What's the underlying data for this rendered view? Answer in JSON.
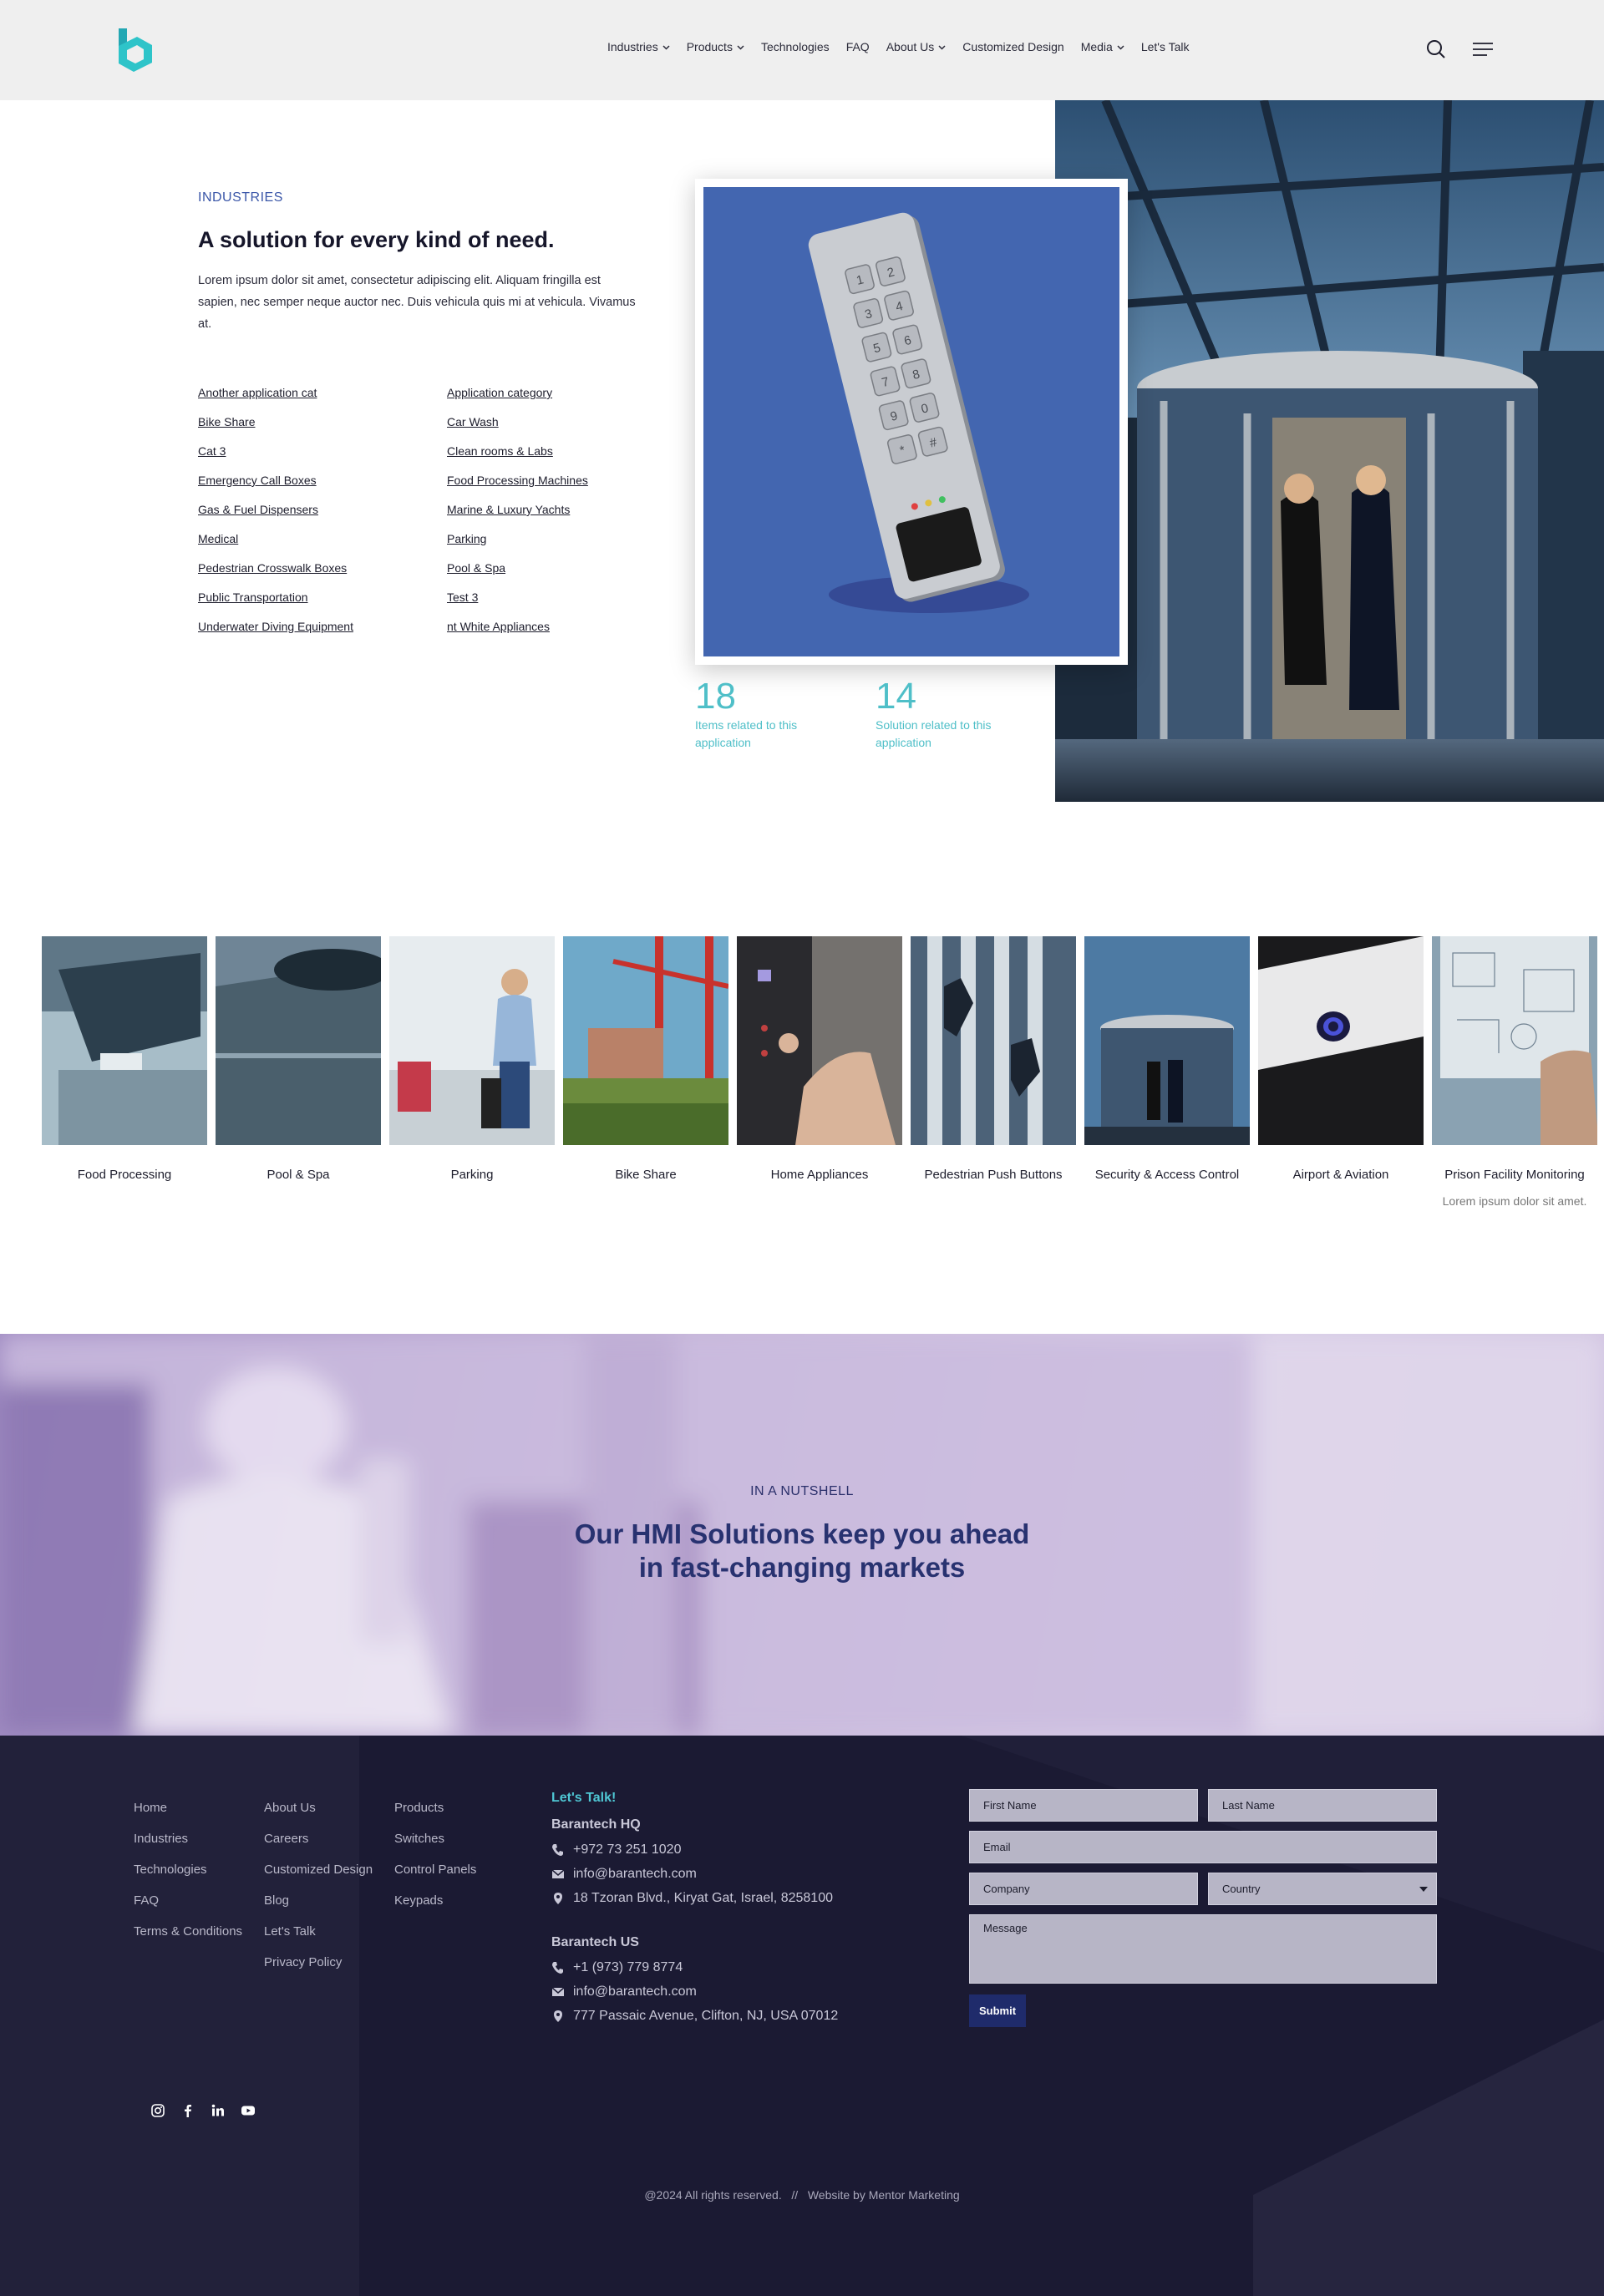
{
  "header": {
    "nav": [
      {
        "label": "Industries",
        "dropdown": true
      },
      {
        "label": "Products",
        "dropdown": true
      },
      {
        "label": "Technologies",
        "dropdown": false
      },
      {
        "label": "FAQ",
        "dropdown": false
      },
      {
        "label": "About Us",
        "dropdown": true
      },
      {
        "label": "Customized Design",
        "dropdown": false
      },
      {
        "label": "Media",
        "dropdown": true
      },
      {
        "label": "Let's Talk",
        "dropdown": false
      }
    ],
    "icons": [
      "search-icon",
      "menu-icon"
    ]
  },
  "hero": {
    "eyebrow": "INDUSTRIES",
    "title": "A solution for every kind of need.",
    "paragraph": "Lorem ipsum dolor sit amet, consectetur adipiscing elit. Aliquam fringilla est sapien, nec semper neque auctor nec. Duis vehicula quis mi at vehicula. Vivamus at.",
    "links": [
      "Another application cat",
      "Application category",
      "Bike Share",
      "Car Wash",
      "Cat 3",
      "Clean rooms & Labs",
      "Emergency Call Boxes",
      "Food Processing Machines",
      "Gas & Fuel Dispensers",
      "Marine & Luxury Yachts",
      "Medical",
      "Parking",
      "Pedestrian Crosswalk Boxes",
      "Pool & Spa",
      "Public Transportation",
      "Test 3",
      "Underwater Diving Equipment",
      "nt White Appliances"
    ],
    "keypad_keys": [
      "1",
      "2",
      "3",
      "4",
      "5",
      "6",
      "7",
      "8",
      "9",
      "0",
      "*",
      "#"
    ],
    "stats": [
      {
        "number": "18",
        "label": "Items related to this application"
      },
      {
        "number": "14",
        "label": "Solution related to this application"
      }
    ]
  },
  "categories": [
    {
      "label": "Food Processing",
      "desc": ""
    },
    {
      "label": "Pool & Spa",
      "desc": ""
    },
    {
      "label": "Parking",
      "desc": ""
    },
    {
      "label": "Bike Share",
      "desc": ""
    },
    {
      "label": "Home Appliances",
      "desc": ""
    },
    {
      "label": "Pedestrian Push Buttons",
      "desc": ""
    },
    {
      "label": "Security & Access Control",
      "desc": ""
    },
    {
      "label": "Airport & Aviation",
      "desc": ""
    },
    {
      "label": "Prison Facility Monitoring",
      "desc": "Lorem ipsum dolor sit amet."
    }
  ],
  "nutshell": {
    "eyebrow": "IN A NUTSHELL",
    "title_line1": "Our HMI Solutions keep you ahead",
    "title_line2": "in fast-changing markets"
  },
  "footer": {
    "col1": [
      "Home",
      "Industries",
      "Technologies",
      "FAQ",
      "Terms & Conditions"
    ],
    "col2": [
      "About Us",
      "Careers",
      "Customized Design",
      "Blog",
      "Let's Talk",
      "Privacy Policy"
    ],
    "col3": [
      "Products",
      "Switches",
      "Control Panels",
      "Keypads"
    ],
    "contact": {
      "heading": "Let's Talk!",
      "hq": {
        "name": "Barantech HQ",
        "phone": "+972 73 251 1020",
        "email": "info@barantech.com",
        "address": "18 Tzoran Blvd., Kiryat Gat, Israel, 8258100"
      },
      "us": {
        "name": "Barantech US",
        "phone": "+1 (973) 779 8774",
        "email": "info@barantech.com",
        "address": "777 Passaic Avenue, Clifton, NJ, USA 07012"
      }
    },
    "form": {
      "first_name": "First Name",
      "last_name": "Last Name",
      "email": "Email",
      "company": "Company",
      "country": "Country",
      "message": "Message",
      "submit": "Submit"
    },
    "social": [
      "instagram-icon",
      "facebook-icon",
      "linkedin-icon",
      "youtube-icon"
    ],
    "copyright": "@2024 All rights reserved.   //   Website by Mentor Marketing"
  },
  "colors": {
    "accent": "#4fc7d4",
    "brand_blue": "#283270",
    "footer_bg": "#1b1a33",
    "product_bg": "#4366b0"
  }
}
